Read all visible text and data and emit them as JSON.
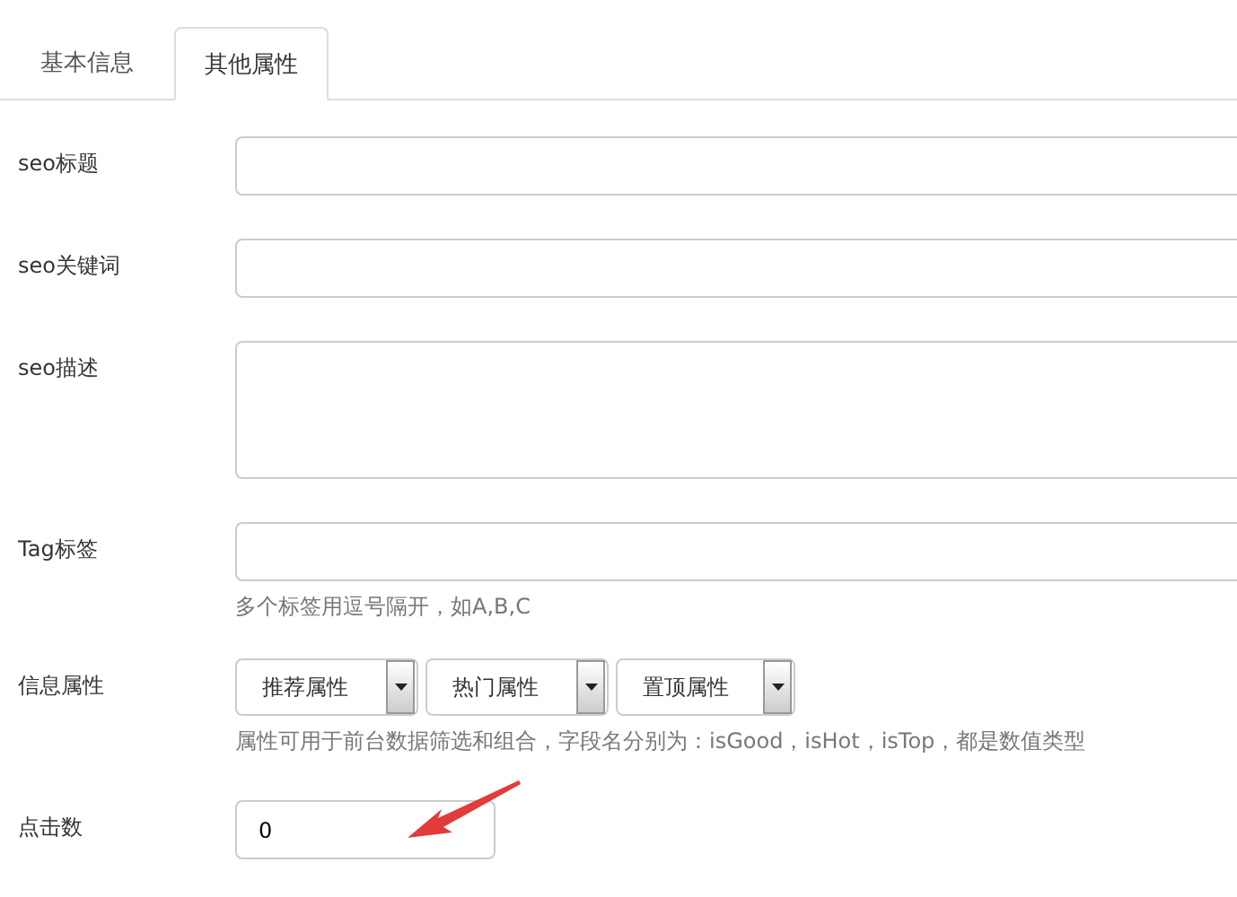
{
  "tabs": [
    {
      "label": "基本信息",
      "selected": false
    },
    {
      "label": "其他属性",
      "selected": true
    }
  ],
  "fields": [
    {
      "kind": "text",
      "label": "seo标题"
    },
    {
      "kind": "text",
      "label": "seo关键词"
    },
    {
      "kind": "textarea",
      "label": "seo描述"
    },
    {
      "kind": "text",
      "label": "Tag标签",
      "help": "多个标签用逗号隔开，如A,B,C"
    },
    {
      "kind": "selects",
      "label": "信息属性",
      "options": [
        "推荐属性",
        "热门属性",
        "置顶属性"
      ],
      "help": "属性可用于前台数据筛选和组合，字段名分别为：isGood，isHot，isTop，都是数值类型"
    },
    {
      "kind": "number",
      "label": "点击数",
      "value": "0",
      "annotated": true
    }
  ]
}
